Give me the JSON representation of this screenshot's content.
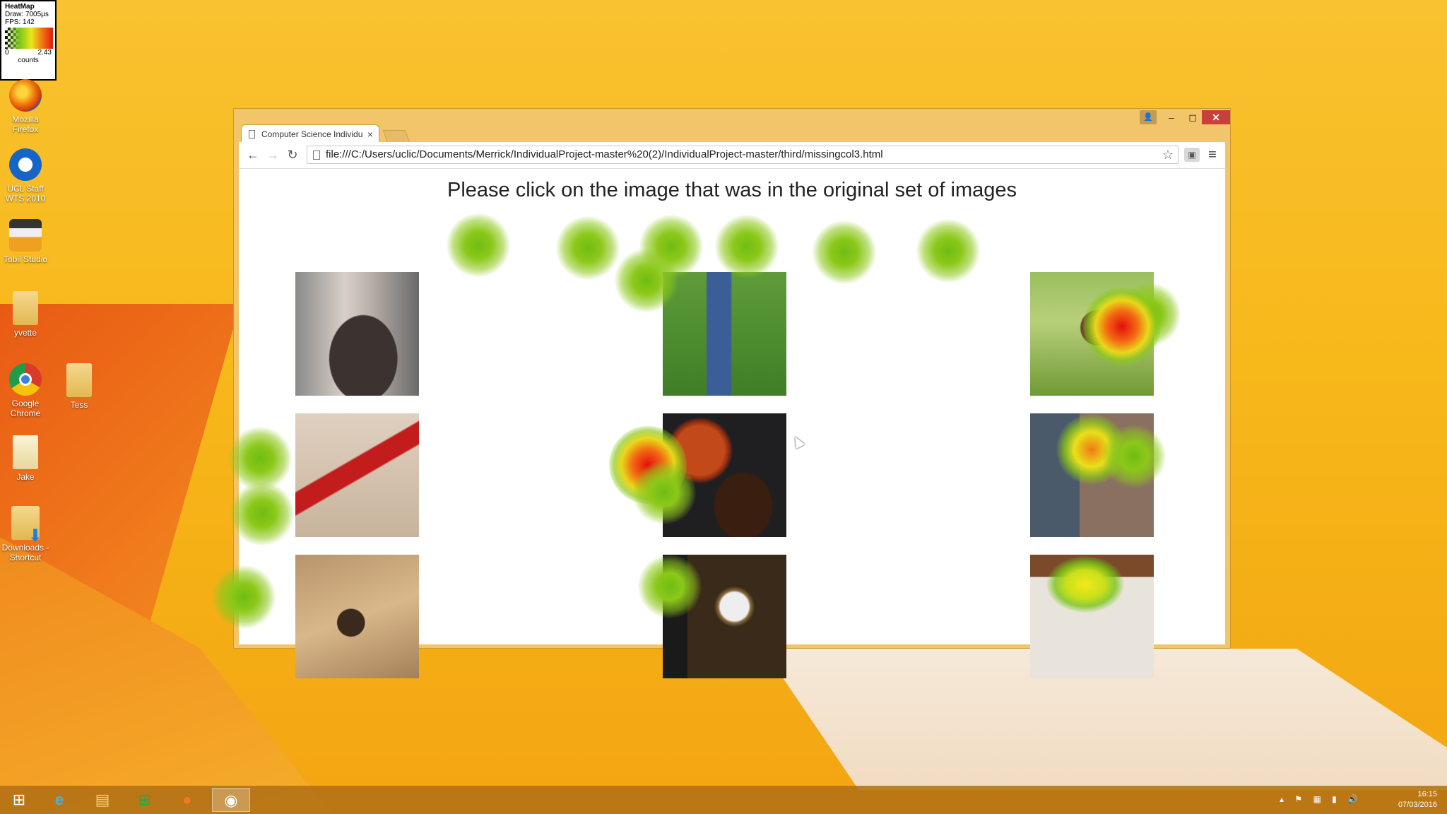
{
  "heatmap_legend": {
    "title": "HeatMap",
    "draw": "Draw: 7005µs",
    "fps": "FPS: 142",
    "min": "0",
    "max": "2.43",
    "unit": "counts"
  },
  "desktop_icons": [
    {
      "label": "Mozilla Firefox",
      "icon": "firefox-icon"
    },
    {
      "label": "UCL Staff WTS 2010",
      "icon": "remote-desktop-icon"
    },
    {
      "label": "Tobii Studio",
      "icon": "tobii-studio-icon"
    },
    {
      "label": "yvette",
      "icon": "folder-icon"
    },
    {
      "label": "Google Chrome",
      "icon": "chrome-icon"
    },
    {
      "label": "Tess",
      "icon": "folder-icon"
    },
    {
      "label": "Jake",
      "icon": "document-icon"
    },
    {
      "label": "Downloads - Shortcut",
      "icon": "downloads-shortcut-icon"
    }
  ],
  "browser": {
    "tab_title": "Computer Science Individu",
    "url": "file:///C:/Users/uclic/Documents/Merrick/IndividualProject-master%20(2)/IndividualProject-master/third/missingcol3.html",
    "close_glyph": "✕",
    "min_glyph": "–",
    "max_glyph": "◻",
    "tab_close_glyph": "×"
  },
  "page": {
    "prompt": "Please click on the image that was in the original set of images",
    "images": [
      {
        "name": "beard"
      },
      {
        "name": "grass-feet"
      },
      {
        "name": "dog"
      },
      {
        "name": "tools-walnuts"
      },
      {
        "name": "coffee-cup"
      },
      {
        "name": "fence"
      },
      {
        "name": "gavel"
      },
      {
        "name": "radio"
      },
      {
        "name": "pocket"
      }
    ]
  },
  "taskbar": {
    "time": "16:15",
    "date": "07/03/2016"
  },
  "colors": {
    "desktop": "#f7b81a",
    "window_frame": "#f3c56a",
    "close_button": "#c7403a",
    "heat_green": "#8cc81a",
    "heat_red": "#e40e0e"
  }
}
